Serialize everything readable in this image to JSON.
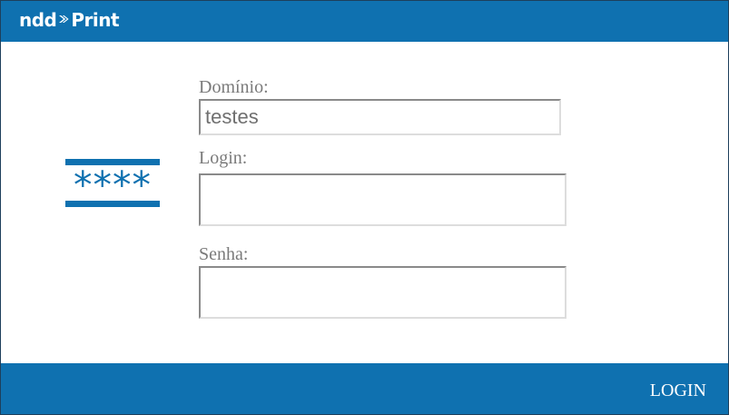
{
  "brand": {
    "logo_part_1": "ndd",
    "logo_part_2": "Print",
    "logo_accent": "#ffffff"
  },
  "hero_symbol": {
    "text": "****",
    "icon": "password-icon"
  },
  "form": {
    "domain": {
      "label": "Domínio:",
      "value": "testes",
      "placeholder": ""
    },
    "login": {
      "label": "Login:",
      "value": "",
      "placeholder": ""
    },
    "password": {
      "label": "Senha:",
      "value": "",
      "placeholder": ""
    }
  },
  "actions": {
    "login_label": "LOGIN"
  },
  "colors": {
    "primary": "#0f71b0",
    "label_text": "#7a7a7a",
    "input_text": "#6f6f6f",
    "background": "#ffffff"
  }
}
